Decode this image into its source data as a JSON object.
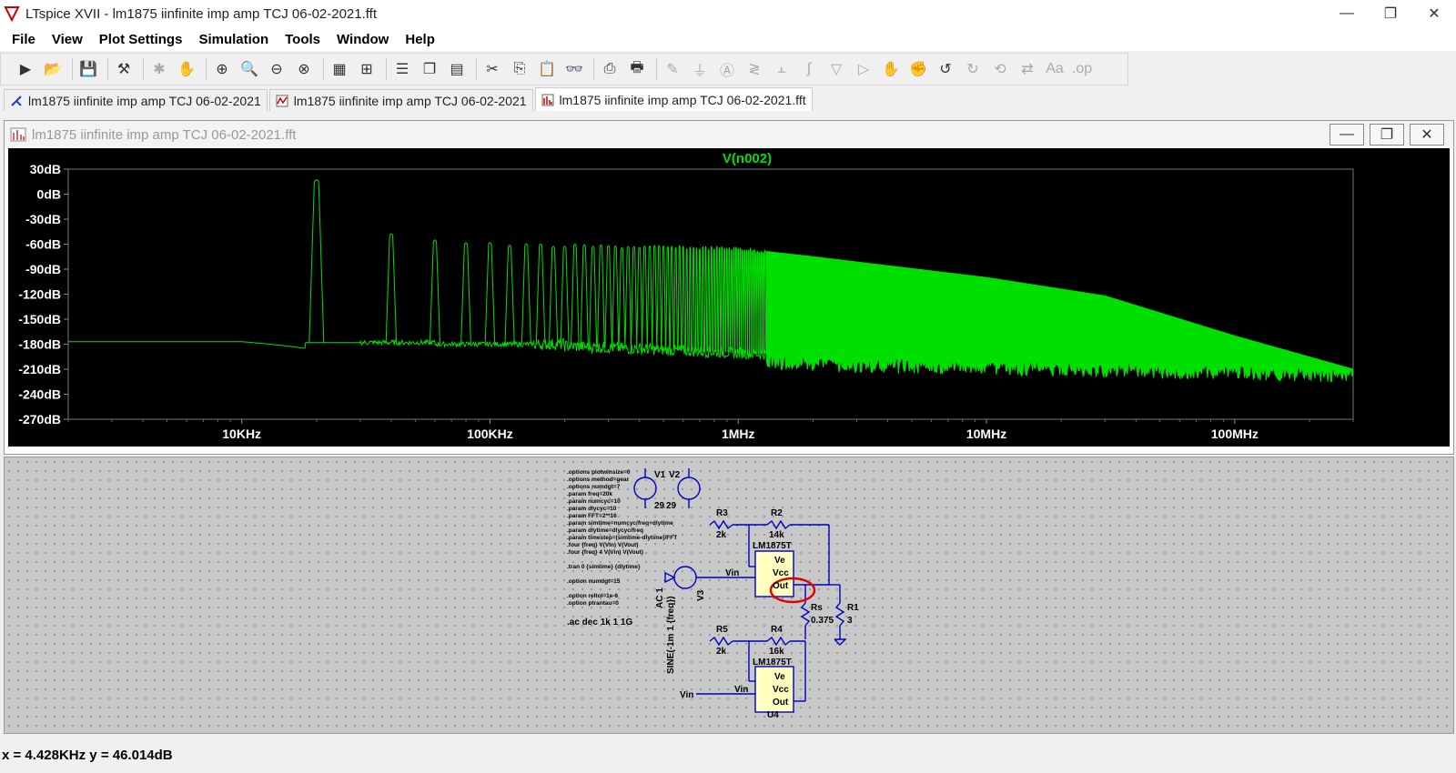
{
  "window": {
    "title": "LTspice XVII - lm1875 iinfinite imp amp TCJ 06-02-2021.fft",
    "minimize": "—",
    "restore": "❐",
    "close": "✕"
  },
  "menu": [
    "File",
    "View",
    "Plot Settings",
    "Simulation",
    "Tools",
    "Window",
    "Help"
  ],
  "tabs": [
    {
      "label": "lm1875 iinfinite imp amp TCJ 06-02-2021",
      "icon": "schematic-icon"
    },
    {
      "label": "lm1875 iinfinite imp amp TCJ 06-02-2021",
      "icon": "waveform-icon"
    },
    {
      "label": "lm1875 iinfinite imp amp TCJ 06-02-2021.fft",
      "icon": "fft-icon",
      "active": true
    }
  ],
  "plot_window": {
    "title": "lm1875 iinfinite imp amp TCJ 06-02-2021.fft"
  },
  "chart_data": {
    "type": "line",
    "title": "V(n002)",
    "xscale": "log",
    "xlim": [
      2000,
      300000000
    ],
    "ylim": [
      -270,
      30
    ],
    "yticks": [
      "30dB",
      "0dB",
      "-30dB",
      "-60dB",
      "-90dB",
      "-120dB",
      "-150dB",
      "-180dB",
      "-210dB",
      "-240dB",
      "-270dB"
    ],
    "xticks": [
      "10KHz",
      "100KHz",
      "1MHz",
      "10MHz",
      "100MHz"
    ],
    "series_color": "#00e000",
    "fundamental_hz": 20000,
    "series": [
      {
        "name": "V(n002)",
        "x": [
          2000,
          5000,
          10000,
          15000,
          19000,
          20000,
          21000,
          40000,
          60000,
          100000,
          200000,
          400000,
          1000000,
          2000000,
          10000000,
          30000000,
          100000000,
          300000000
        ],
        "y": [
          -177,
          -177,
          -179,
          -186,
          -186,
          15,
          -186,
          -50,
          -55,
          -60,
          -62,
          -63,
          -65,
          -75,
          -100,
          -122,
          -170,
          -210
        ]
      }
    ]
  },
  "schematic": {
    "spice_lines": [
      ".options plotwinsize=0",
      ".options method=gear",
      ".options numdgt=7",
      ".param freq=20k",
      ".param numcyc=10",
      ".param dlycyc=10",
      ".param FFT=2**16",
      ".param simtime=numcyc/freq+dlytime",
      ".param dlytime=dlycyc/freq",
      ".param timestep=(simtime-dlytime)/FFT",
      ".four {freq} V(Vin) V(Vout)",
      ".four {freq} 4 V(Vin) V(Vout)",
      ".tran 0 {simtime} {dlytime}",
      ".option numdgt=15",
      ".option reltol=1e-6",
      ".option ptrantau=0",
      ".ac dec 1k 1 1G"
    ],
    "sources": {
      "v1": "V1",
      "v2": "V2",
      "v1_val": "29",
      "v2_val": "29",
      "v3": "V3",
      "v3_ac": "AC 1",
      "v3_sine": "SINE(-1m 1 {freq})"
    },
    "parts": {
      "r3": "R3",
      "r3_val": "2k",
      "r2": "R2",
      "r2_val": "14k",
      "u_top": "LM1875T",
      "u_bot": "LM1875T",
      "u4": "U4",
      "r5": "R5",
      "r5_val": "2k",
      "r4": "R4",
      "r4_val": "16k",
      "rs": "Rs",
      "rs_val": "0.375",
      "r1": "R1",
      "r1_val": "3",
      "pin_ve": "Ve",
      "pin_vcc": "Vcc",
      "pin_out": "Out",
      "net_vin": "Vin"
    }
  },
  "status": {
    "text": "x = 4.428KHz    y = 46.014dB"
  }
}
